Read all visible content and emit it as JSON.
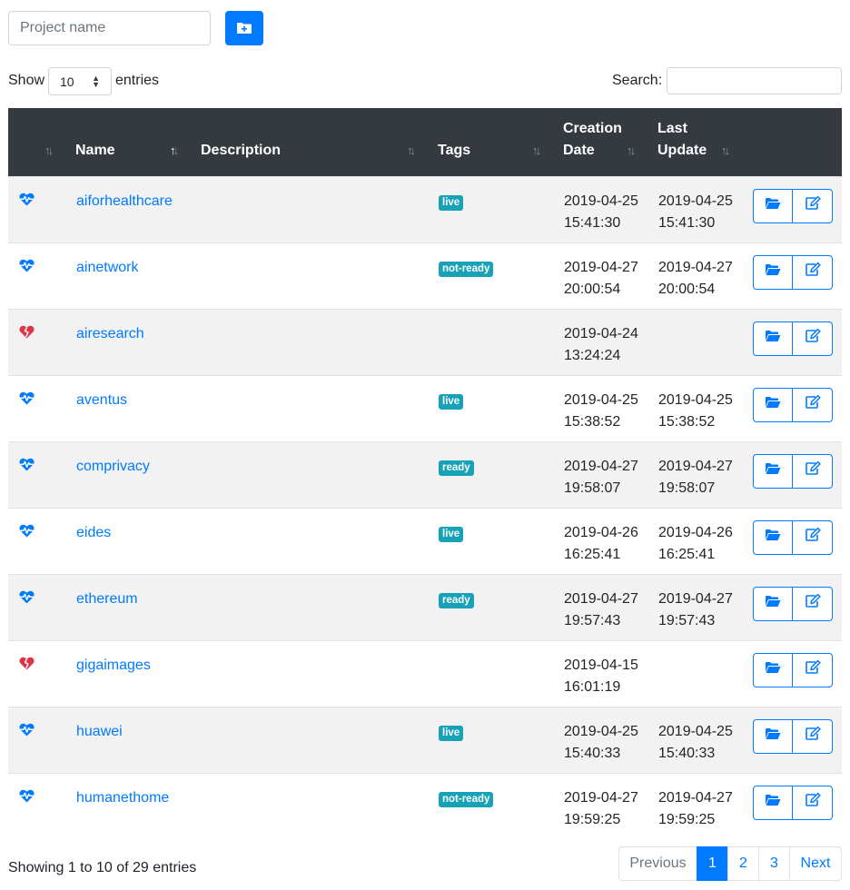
{
  "toolbar": {
    "project_placeholder": "Project name",
    "add_icon": "folder-plus-icon"
  },
  "length": {
    "show_label": "Show",
    "value": "10",
    "entries_label": "entries"
  },
  "search": {
    "label": "Search:",
    "value": ""
  },
  "table": {
    "headers": {
      "name": "Name",
      "description": "Description",
      "tags": "Tags",
      "created": "Creation\nDate",
      "updated": "Last\nUpdate"
    },
    "rows": [
      {
        "status": "healthy",
        "name": "aiforhealthcare",
        "tag": "live",
        "created": "2019-04-25\n15:41:30",
        "updated": "2019-04-25\n15:41:30"
      },
      {
        "status": "healthy",
        "name": "ainetwork",
        "tag": "not-ready",
        "created": "2019-04-27\n20:00:54",
        "updated": "2019-04-27\n20:00:54"
      },
      {
        "status": "broken",
        "name": "airesearch",
        "tag": "",
        "created": "2019-04-24\n13:24:24",
        "updated": ""
      },
      {
        "status": "healthy",
        "name": "aventus",
        "tag": "live",
        "created": "2019-04-25\n15:38:52",
        "updated": "2019-04-25\n15:38:52"
      },
      {
        "status": "healthy",
        "name": "comprivacy",
        "tag": "ready",
        "created": "2019-04-27\n19:58:07",
        "updated": "2019-04-27\n19:58:07"
      },
      {
        "status": "healthy",
        "name": "eides",
        "tag": "live",
        "created": "2019-04-26\n16:25:41",
        "updated": "2019-04-26\n16:25:41"
      },
      {
        "status": "healthy",
        "name": "ethereum",
        "tag": "ready",
        "created": "2019-04-27\n19:57:43",
        "updated": "2019-04-27\n19:57:43"
      },
      {
        "status": "broken",
        "name": "gigaimages",
        "tag": "",
        "created": "2019-04-15\n16:01:19",
        "updated": ""
      },
      {
        "status": "healthy",
        "name": "huawei",
        "tag": "live",
        "created": "2019-04-25\n15:40:33",
        "updated": "2019-04-25\n15:40:33"
      },
      {
        "status": "healthy",
        "name": "humanethome",
        "tag": "not-ready",
        "created": "2019-04-27\n19:59:25",
        "updated": "2019-04-27\n19:59:25"
      }
    ]
  },
  "footer": {
    "info": "Showing 1 to 10 of 29 entries"
  },
  "pagination": {
    "previous": "Previous",
    "pages": [
      "1",
      "2",
      "3"
    ],
    "next": "Next"
  },
  "colors": {
    "primary": "#007bff",
    "danger": "#dc3545",
    "info": "#17a2b8",
    "header": "#343a40"
  }
}
